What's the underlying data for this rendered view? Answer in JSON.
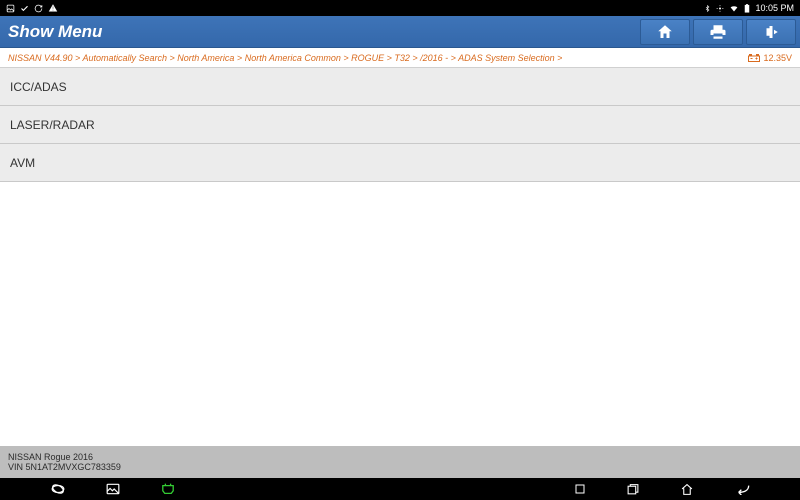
{
  "statusbar": {
    "time": "10:05 PM"
  },
  "titlebar": {
    "title": "Show Menu"
  },
  "breadcrumb": {
    "text": "NISSAN V44.90 > Automatically Search > North America > North America Common > ROGUE > T32 > /2016 - > ADAS System Selection >",
    "voltage": "12.35V"
  },
  "menu": {
    "items": [
      {
        "label": "ICC/ADAS"
      },
      {
        "label": "LASER/RADAR"
      },
      {
        "label": "AVM"
      }
    ]
  },
  "footer": {
    "line1": "NISSAN Rogue 2016",
    "line2": "VIN 5N1AT2MVXGC783359"
  }
}
